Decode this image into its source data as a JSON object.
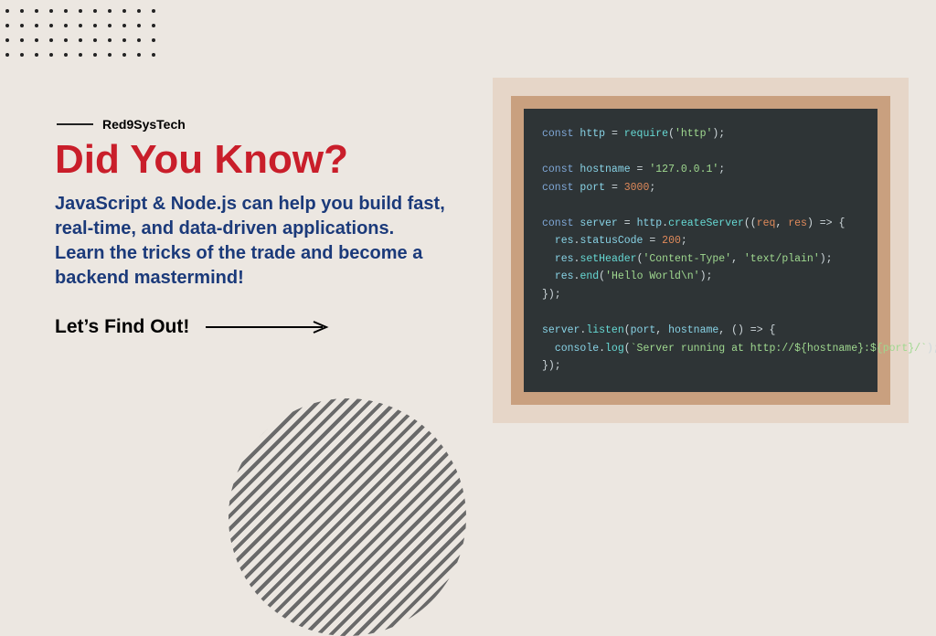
{
  "brand": "Red9SysTech",
  "headline": "Did You Know?",
  "description": "JavaScript & Node.js can help you build fast, real-time, and data-driven applications. Learn the tricks of the trade and become a backend mastermind!",
  "cta": "Let’s Find Out!",
  "code": {
    "l1_kw": "const",
    "l1_id": "http",
    "l1_fn": "require",
    "l1_str": "'http'",
    "l3_kw": "const",
    "l3_id": "hostname",
    "l3_str": "'127.0.0.1'",
    "l4_kw": "const",
    "l4_id": "port",
    "l4_num": "3000",
    "l6_kw": "const",
    "l6_id": "server",
    "l6_obj": "http",
    "l6_fn": "createServer",
    "l6_arg1": "req",
    "l6_arg2": "res",
    "l7_obj": "res",
    "l7_prop": "statusCode",
    "l7_num": "200",
    "l8_obj": "res",
    "l8_fn": "setHeader",
    "l8_str1": "'Content-Type'",
    "l8_str2": "'text/plain'",
    "l9_obj": "res",
    "l9_fn": "end",
    "l9_str": "'Hello World\\n'",
    "l10_close": "});",
    "l12_obj": "server",
    "l12_fn": "listen",
    "l12_arg1": "port",
    "l12_arg2": "hostname",
    "l13_obj": "console",
    "l13_fn": "log",
    "l13_str": "`Server running at http://${hostname}:${port}/`",
    "l14_close": "});"
  }
}
